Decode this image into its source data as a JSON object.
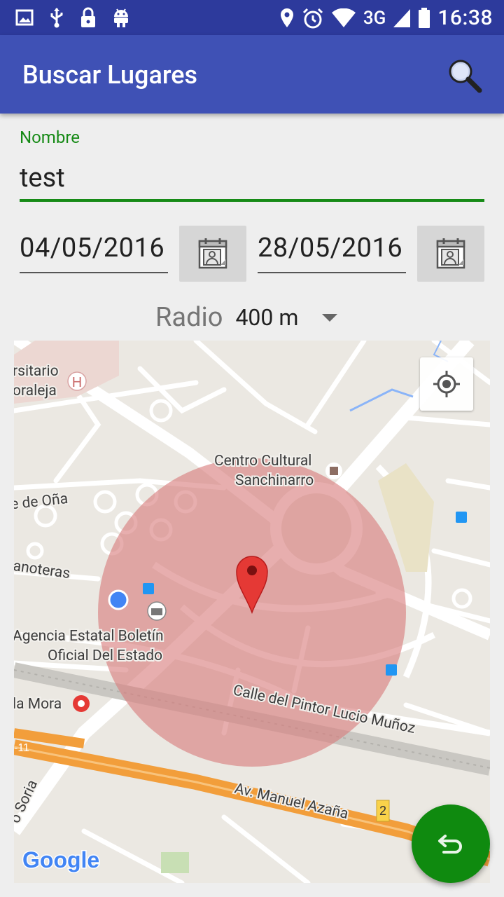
{
  "status_bar": {
    "network": "3G",
    "time": "16:38"
  },
  "app_bar": {
    "title": "Buscar Lugares"
  },
  "form": {
    "name_label": "Nombre",
    "name_value": "test",
    "date_from": "04/05/2016",
    "date_to": "28/05/2016",
    "radius_label": "Radio",
    "radius_value": "400 m"
  },
  "map": {
    "labels": {
      "universitario": "rsitario",
      "moraleja": "oraleja",
      "de_ona": "e de Oña",
      "anoteras": "anoteras",
      "centro_cultural_1": "Centro Cultural",
      "centro_cultural_2": "Sanchinarro",
      "agencia_1": "Agencia Estatal Boletín",
      "agencia_2": "Oficial Del Estado",
      "la_mora": "la Mora",
      "calle_pintor": "Calle del Pintor Lucio Muñoz",
      "av_manuel": "Av. Manuel Azaña",
      "soria": "o Soria",
      "road_num": "2",
      "road_m11": "-11",
      "hospital": "H"
    },
    "google_logo": "Google"
  },
  "colors": {
    "primary": "#3f51b5",
    "primary_dark": "#2d3a9c",
    "accent_green": "#168a16",
    "fab": "#0f8a0f",
    "circle_fill": "#d87c7c",
    "marker": "#e53935"
  }
}
